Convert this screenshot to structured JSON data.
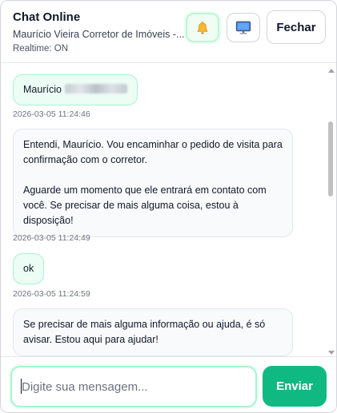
{
  "header": {
    "title": "Chat Online",
    "subtitle": "Maurício Vieira Corretor de Imóveis -...",
    "status": "Realtime: ON",
    "close_label": "Fechar"
  },
  "icons": {
    "bell": "bell-icon",
    "monitor": "monitor-icon"
  },
  "messages": [
    {
      "role": "user",
      "text": "Maurício",
      "has_redacted": true,
      "time": "2026-03-05 11:24:46"
    },
    {
      "role": "agent",
      "text": "Entendi, Maurício. Vou encaminhar o pedido de visita para confirmação com o corretor.\n\nAguarde um momento que ele entrará em contato com você. Se precisar de mais alguma coisa, estou à disposição!",
      "time": "2026-03-05 11:24:49"
    },
    {
      "role": "user",
      "text": "ok",
      "time": "2026-03-05 11:24:59"
    },
    {
      "role": "agent",
      "text": "Se precisar de mais alguma informação ou ajuda, é só avisar. Estou aqui para ajudar!"
    }
  ],
  "composer": {
    "placeholder": "Digite sua mensagem...",
    "value": "",
    "send_label": "Enviar"
  },
  "colors": {
    "accent": "#10b981",
    "user_bubble": "#ecfdf5",
    "agent_bubble": "#f8fafc"
  }
}
